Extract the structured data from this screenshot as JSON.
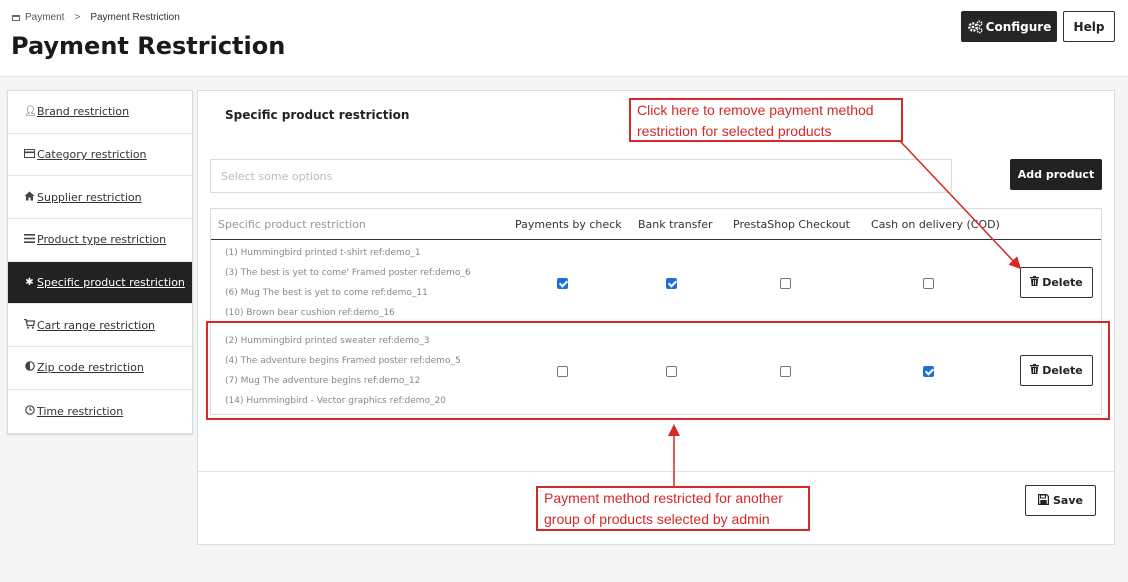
{
  "breadcrumb": {
    "parent": "Payment",
    "separator": ">",
    "current": "Payment Restriction"
  },
  "page_title": "Payment Restriction",
  "toolbar": {
    "configure_label": "Configure",
    "help_label": "Help"
  },
  "sidebar": {
    "items": [
      {
        "label": "Brand restriction",
        "icon": "user-icon",
        "active": false
      },
      {
        "label": "Category restriction",
        "icon": "credit-card-icon",
        "active": false
      },
      {
        "label": "Supplier restriction",
        "icon": "home-icon",
        "active": false
      },
      {
        "label": "Product type restriction",
        "icon": "list-icon",
        "active": false
      },
      {
        "label": "Specific product restriction",
        "icon": "asterisk-icon",
        "active": true
      },
      {
        "label": "Cart range restriction",
        "icon": "cart-icon",
        "active": false
      },
      {
        "label": "Zip code restriction",
        "icon": "adjust-icon",
        "active": false
      },
      {
        "label": "Time restriction",
        "icon": "clock-icon",
        "active": false
      }
    ]
  },
  "main": {
    "title": "Specific product restriction",
    "select_placeholder": "Select some options",
    "add_product_label": "Add product",
    "columns": [
      "Specific product restriction",
      "Payments by check",
      "Bank transfer",
      "PrestaShop Checkout",
      "Cash on delivery (COD)"
    ],
    "rows": [
      {
        "products": [
          "(1) Hummingbird printed t-shirt ref:demo_1",
          "(3) The best is yet to come' Framed poster ref:demo_6",
          "(6) Mug The best is yet to come ref:demo_11",
          "(10) Brown bear cushion ref:demo_16"
        ],
        "checks": [
          true,
          true,
          false,
          false
        ],
        "delete_label": "Delete"
      },
      {
        "products": [
          "(2) Hummingbird printed sweater ref:demo_3",
          "(4) The adventure begins Framed poster ref:demo_5",
          "(7) Mug The adventure begins ref:demo_12",
          "(14) Hummingbird - Vector graphics ref:demo_20"
        ],
        "checks": [
          false,
          false,
          false,
          true
        ],
        "delete_label": "Delete"
      }
    ],
    "save_label": "Save"
  },
  "annotations": {
    "top_callout": [
      "Click here to remove payment method",
      "restriction for selected products"
    ],
    "bottom_callout": [
      "Payment method restricted for another",
      "group of products selected by admin"
    ],
    "color": "#d62828"
  }
}
